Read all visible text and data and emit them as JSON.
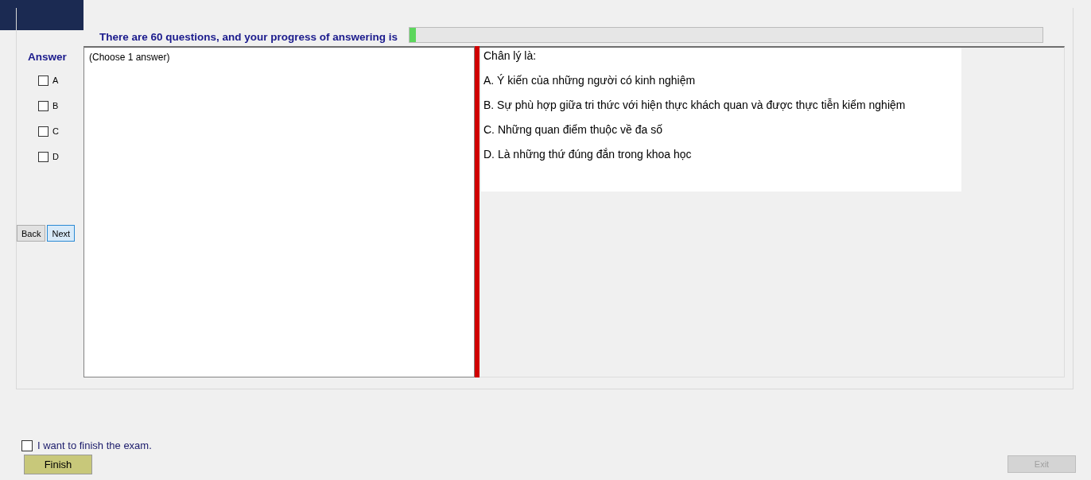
{
  "header": {
    "progress_text": "There are 60 questions, and your progress of answering is",
    "progress": {
      "level": 0.01
    }
  },
  "answer_panel": {
    "title": "Answer",
    "options": [
      {
        "label": "A",
        "checked": false
      },
      {
        "label": "B",
        "checked": false
      },
      {
        "label": "C",
        "checked": false
      },
      {
        "label": "D",
        "checked": false
      }
    ],
    "buttons": [
      {
        "label": "Back",
        "kind": "plain"
      },
      {
        "label": "Next",
        "kind": "focused"
      }
    ]
  },
  "answer_area": {
    "hint": "(Choose 1 answer)"
  },
  "question": {
    "text": "Chân lý là:",
    "choices": [
      "A.  Ý kiến của những người có kinh nghiệm",
      "B.  Sự phù hợp giữa tri thức với hiện thực khách quan và được thực tiễn kiểm nghiệm",
      "C.  Những quan điểm thuộc về đa số",
      "D.  Là những thứ đúng đắn trong khoa học"
    ]
  },
  "footer": {
    "finish_confirm": {
      "label": "I want to finish the exam.",
      "checked": false
    },
    "finish_button": {
      "label": "Finish",
      "disabled": false
    },
    "exit_button": {
      "label": "Exit",
      "disabled": true
    }
  }
}
